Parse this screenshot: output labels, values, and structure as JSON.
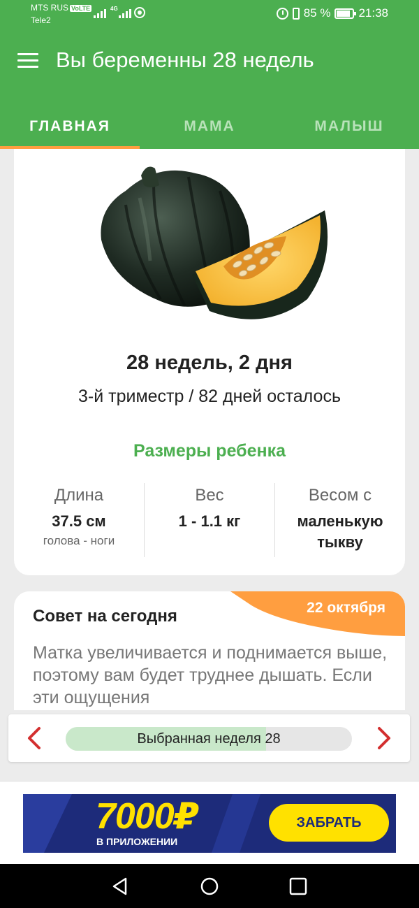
{
  "status_bar": {
    "carrier_primary": "MTS RUS",
    "volte_badge": "VoLTE",
    "carrier_secondary": "Tele2",
    "network_type": "4G",
    "battery": "85 %",
    "time": "21:38",
    "icons": [
      "signal-icon",
      "hotspot-icon",
      "alarm-icon",
      "vibrate-icon",
      "battery-icon"
    ]
  },
  "app_bar": {
    "title": "Вы беременны 28 недель",
    "menu_icon": "hamburger-menu-icon"
  },
  "tabs": [
    {
      "label": "ГЛАВНАЯ",
      "active": true
    },
    {
      "label": "МАМА",
      "active": false
    },
    {
      "label": "МАЛЫШ",
      "active": false
    }
  ],
  "accent_colors": {
    "primary": "#4caf50",
    "tab_indicator": "#ff9e40",
    "date_badge": "#ff9e40",
    "progress_fill": "#c9e8ca",
    "arrows": "#d32f2f"
  },
  "overview": {
    "image": "acorn-squash-image",
    "week_title": "28 недель, 2 дня",
    "week_subtitle": "3-й триместр / 82 дней осталось",
    "sizes_title": "Размеры ребенка",
    "columns": [
      {
        "label": "Длина",
        "value": "37.5 см",
        "note": "голова - ноги"
      },
      {
        "label": "Вес",
        "value": "1 - 1.1 кг",
        "note": ""
      },
      {
        "label": "Весом с",
        "value": "маленькую тыкву",
        "note": ""
      }
    ]
  },
  "tip": {
    "title": "Совет на сегодня",
    "date": "22 октября",
    "text": "Матка увеличивается и поднимается выше, поэтому вам будет труднее дышать. Если эти ощущения"
  },
  "week_selector": {
    "label": "Выбранная неделя 28",
    "progress_fraction": 0.7,
    "prev_icon": "chevron-left-icon",
    "next_icon": "chevron-right-icon"
  },
  "ad": {
    "amount": "7000₽",
    "subtitle": "В ПРИЛОЖЕНИИ",
    "button": "ЗАБРАТЬ"
  },
  "nav_bar": {
    "icons": [
      "back-icon",
      "home-icon",
      "recents-icon"
    ]
  }
}
